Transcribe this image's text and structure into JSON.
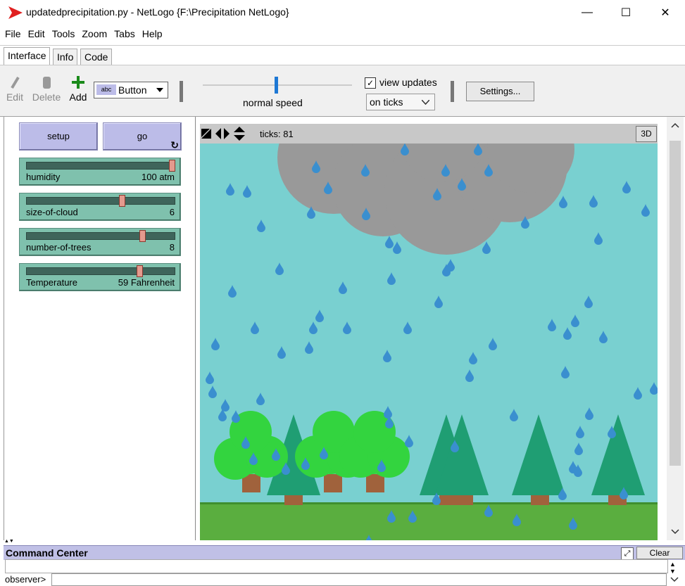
{
  "window": {
    "title": "updatedprecipitation.py - NetLogo {F:\\Precipitation NetLogo}",
    "minimize_glyph": "—",
    "maximize_glyph": "☐",
    "close_glyph": "✕"
  },
  "menu": [
    "File",
    "Edit",
    "Tools",
    "Zoom",
    "Tabs",
    "Help"
  ],
  "tabs": [
    "Interface",
    "Info",
    "Code"
  ],
  "toolbar": {
    "edit_label": "Edit",
    "delete_label": "Delete",
    "add_label": "Add",
    "widget_type": "Button",
    "speed_label": "normal speed",
    "view_updates_label": "view updates",
    "view_updates_checked": true,
    "update_mode": "on ticks",
    "settings_label": "Settings..."
  },
  "buttons": [
    {
      "label": "setup",
      "forever": false
    },
    {
      "label": "go",
      "forever": true,
      "forever_glyph": "↻"
    }
  ],
  "sliders": [
    {
      "label": "humidity",
      "value": "100 atm",
      "fraction": 1.0
    },
    {
      "label": "size-of-cloud",
      "value": "6",
      "fraction": 0.66
    },
    {
      "label": "number-of-trees",
      "value": "8",
      "fraction": 0.8
    },
    {
      "label": "Temperature",
      "value": "59 Fahrenheit",
      "fraction": 0.78
    }
  ],
  "view": {
    "ticks_label": "ticks: 81",
    "three_d_label": "3D",
    "colors": {
      "sky": "#79d0d0",
      "cloud": "#999999",
      "ground": "#5aae3f",
      "rain": "#3a8fcf",
      "trunk": "#a0623c",
      "pine": "#1f9e73",
      "leafy": "#33d43f"
    }
  },
  "command_center": {
    "title": "Command Center",
    "clear_label": "Clear",
    "prompt": "observer>"
  },
  "colors": {
    "button": "#bcbce8",
    "slider": "#7fc1ad",
    "logo": "#e02020"
  }
}
